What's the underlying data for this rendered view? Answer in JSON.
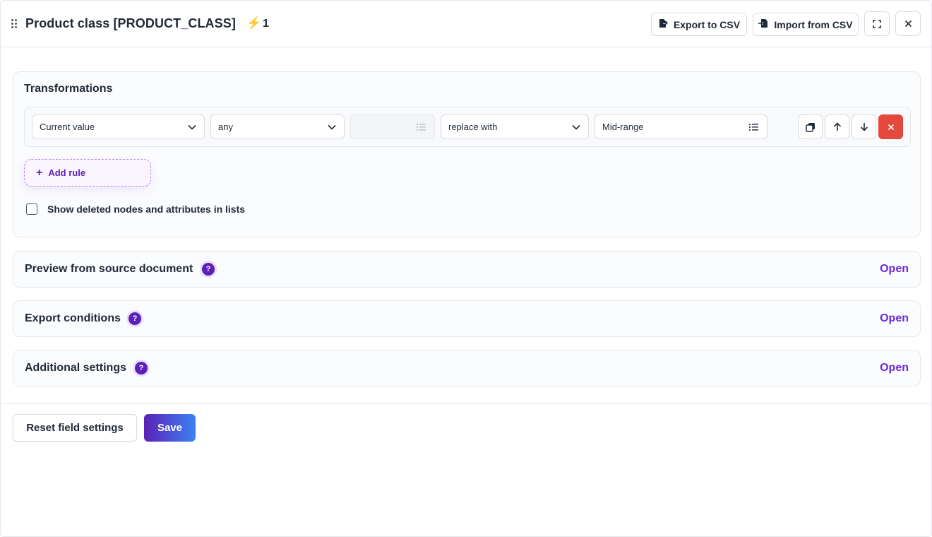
{
  "header": {
    "title": "Product class [PRODUCT_CLASS]",
    "bolt_icon": "lightning-icon",
    "count": "1",
    "export_label": "Export to CSV",
    "import_label": "Import from CSV"
  },
  "transformations": {
    "title": "Transformations",
    "rule": {
      "source": "Current value",
      "condition": "any",
      "condition_value": "",
      "action": "replace with",
      "replacement": "Mid-range"
    },
    "add_rule_label": "Add rule",
    "show_deleted_label": "Show deleted nodes and attributes in lists",
    "show_deleted_checked": false
  },
  "sections": [
    {
      "title": "Preview from source document",
      "action": "Open"
    },
    {
      "title": "Export conditions",
      "action": "Open"
    },
    {
      "title": "Additional settings",
      "action": "Open"
    }
  ],
  "help_glyph": "?",
  "footer": {
    "reset_label": "Reset field settings",
    "save_label": "Save"
  },
  "colors": {
    "accent": "#6d28d9",
    "delete": "#e5483d",
    "bolt": "#f5b400"
  }
}
